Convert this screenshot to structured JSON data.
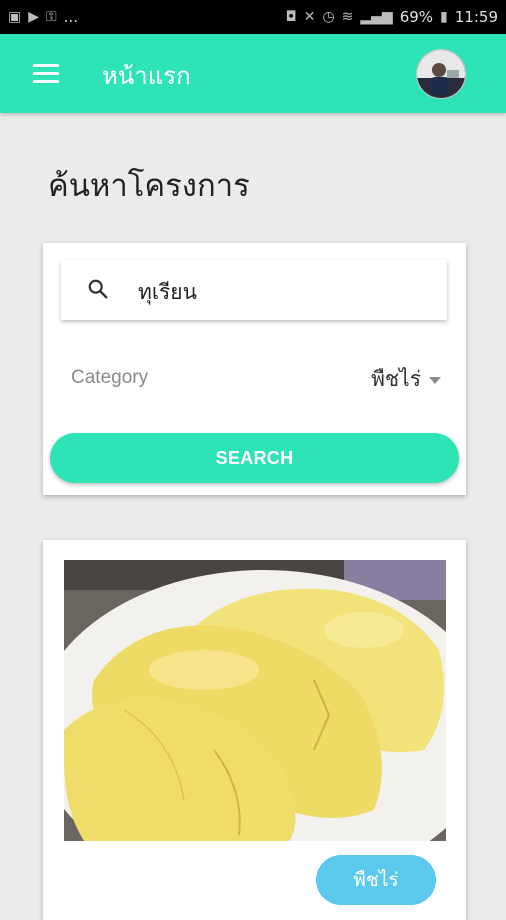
{
  "status_bar": {
    "left_icons": [
      "image-icon",
      "cast-icon",
      "key-icon"
    ],
    "ellipsis": "...",
    "battery": "69%",
    "time": "11:59"
  },
  "app_bar": {
    "title": "หน้าแรก",
    "menu_icon": "hamburger-menu-icon",
    "avatar": "user-avatar"
  },
  "page": {
    "heading": "ค้นหาโครงการ"
  },
  "search": {
    "icon": "search-icon",
    "value": "ทุเรียน",
    "category_label": "Category",
    "category_value": "พืชไร่",
    "button_label": "SEARCH"
  },
  "results": [
    {
      "image": "durian-photo",
      "tag": "พืชไร่"
    }
  ],
  "colors": {
    "accent": "#2ee3b5",
    "chip": "#5bc8ee",
    "background": "#ebebeb"
  }
}
